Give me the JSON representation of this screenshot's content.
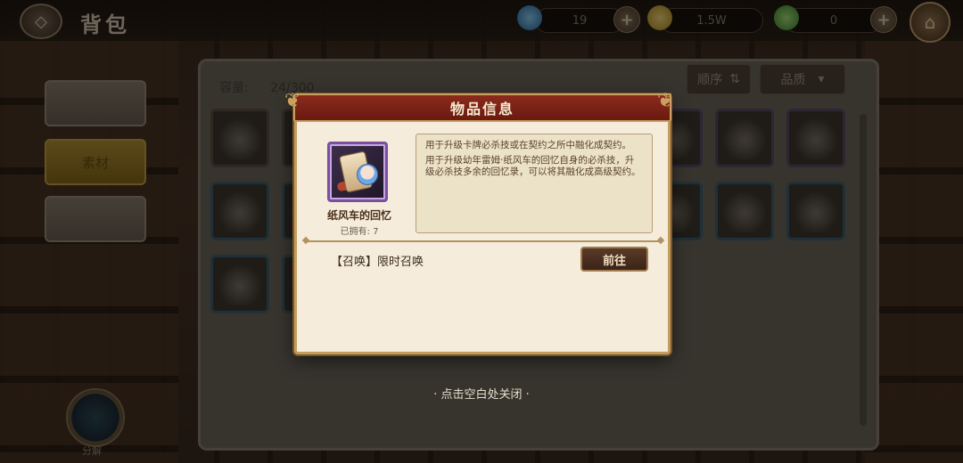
{
  "topbar": {
    "title": "背包",
    "back_icon": "back-diamond-icon",
    "resources": [
      {
        "name": "blue-gem",
        "value": "19",
        "color": "#4da3d8"
      },
      {
        "name": "gold-coin",
        "value": "1.5W",
        "color": "#d9b13e"
      },
      {
        "name": "green-leaf",
        "value": "0",
        "color": "#5fb04a"
      }
    ],
    "home_icon": "home-icon"
  },
  "sidebar": {
    "tabs": [
      {
        "label": "",
        "active": false
      },
      {
        "label": "素材",
        "active": true
      },
      {
        "label": "",
        "active": false
      }
    ],
    "compass_label": "分解"
  },
  "inventory": {
    "capacity_label": "容量:",
    "capacity_value": "24/300",
    "sort_label": "顺序",
    "sort_value": "品质"
  },
  "dialog": {
    "title": "物品信息",
    "item_name": "纸风车的回忆",
    "owned_text": "已拥有: 7",
    "description": [
      "用于升级卡牌必杀技或在契约之所中融化成契约。",
      "用于升级幼年雷姆·纸风车的回忆自身的必杀技，升级必杀技多余的回忆录，可以将其融化成高级契约。"
    ],
    "source_text": "【召唤】限时召唤",
    "go_button": "前往"
  },
  "close_hint": "· 点击空白处关闭 ·"
}
